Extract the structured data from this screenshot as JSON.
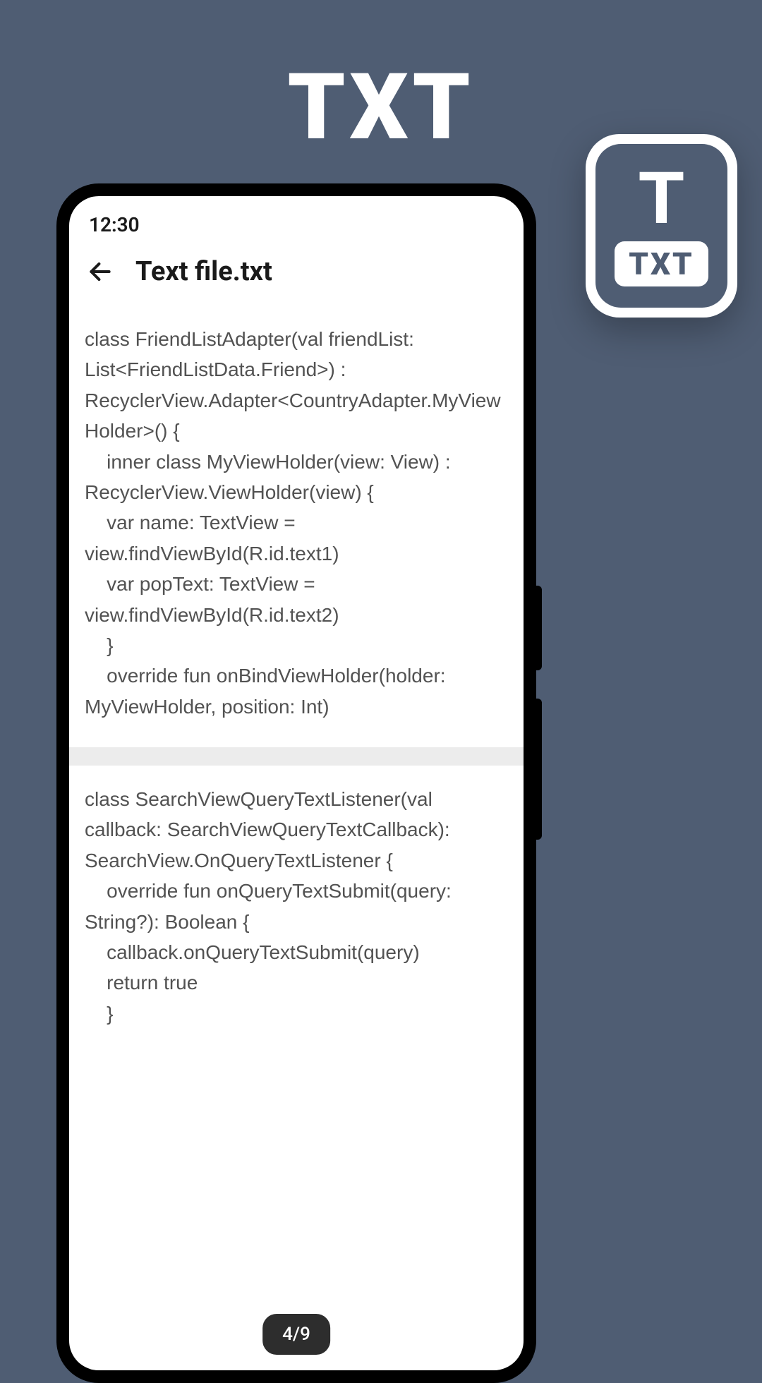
{
  "header": {
    "title": "TXT"
  },
  "floating_icon": {
    "letter": "T",
    "badge": "TXT"
  },
  "status_bar": {
    "time": "12:30"
  },
  "app_header": {
    "file_name": "Text file.txt"
  },
  "content": {
    "block1": "class FriendListAdapter(val friendList: List<FriendListData.Friend>) : RecyclerView.Adapter<CountryAdapter.MyViewHolder>() {\n    inner class MyViewHolder(view: View) : RecyclerView.ViewHolder(view) {\n    var name: TextView = view.findViewById(R.id.text1)\n    var popText: TextView = view.findViewById(R.id.text2)\n    }\n    override fun onBindViewHolder(holder: MyViewHolder, position: Int)",
    "block2": "class SearchViewQueryTextListener(val callback: SearchViewQueryTextCallback): SearchView.OnQueryTextListener {\n    override fun onQueryTextSubmit(query: String?): Boolean {\n    callback.onQueryTextSubmit(query)\n    return true\n    }"
  },
  "page_indicator": "4/9"
}
